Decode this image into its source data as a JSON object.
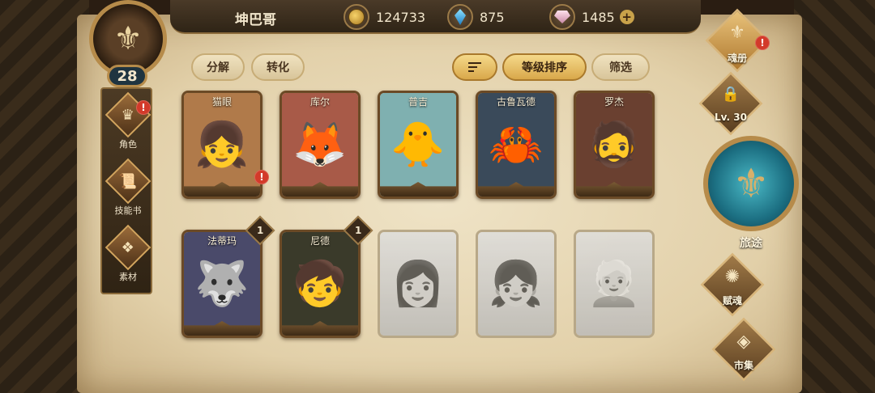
{
  "player": {
    "name": "坤巴哥",
    "level": "28"
  },
  "resources": [
    {
      "icon": "gold-coin-icon",
      "value": "124733"
    },
    {
      "icon": "blue-crystal-icon",
      "value": "875"
    },
    {
      "icon": "pink-gem-icon",
      "value": "1485"
    }
  ],
  "sidebar": {
    "items": [
      {
        "label": "角色",
        "icon": "character-icon",
        "alert": "!"
      },
      {
        "label": "技能书",
        "icon": "skill-book-icon"
      },
      {
        "label": "素材",
        "icon": "material-icon"
      }
    ]
  },
  "filters": {
    "decompose": "分解",
    "convert": "转化",
    "sort_level": "等级排序",
    "filter": "筛选"
  },
  "cards": [
    {
      "name": "猫眼",
      "icon": "👧",
      "bg": "#b07a4a",
      "alert": "!"
    },
    {
      "name": "库尔",
      "icon": "🦊",
      "bg": "#a85a48"
    },
    {
      "name": "普吉",
      "icon": "🐥",
      "bg": "#7fb0b0"
    },
    {
      "name": "古鲁瓦德",
      "icon": "🦀",
      "bg": "#3a4a5a"
    },
    {
      "name": "罗杰",
      "icon": "🧔",
      "bg": "#6a4030"
    },
    {
      "name": "法蒂玛",
      "icon": "🐺",
      "bg": "#4a4a6a",
      "count": "1"
    },
    {
      "name": "尼德",
      "icon": "🧒",
      "bg": "#3a3a2a",
      "count": "1"
    },
    {
      "name": "",
      "icon": "👩",
      "locked": true
    },
    {
      "name": "",
      "icon": "👧",
      "locked": true
    },
    {
      "name": "",
      "icon": "👱",
      "locked": true
    }
  ],
  "right_menu": {
    "soul_book": "魂册",
    "soul_alert": "!",
    "locked_level": "Lv. 30",
    "journey": "旅途",
    "fusion": "赋魂",
    "market": "市集"
  }
}
